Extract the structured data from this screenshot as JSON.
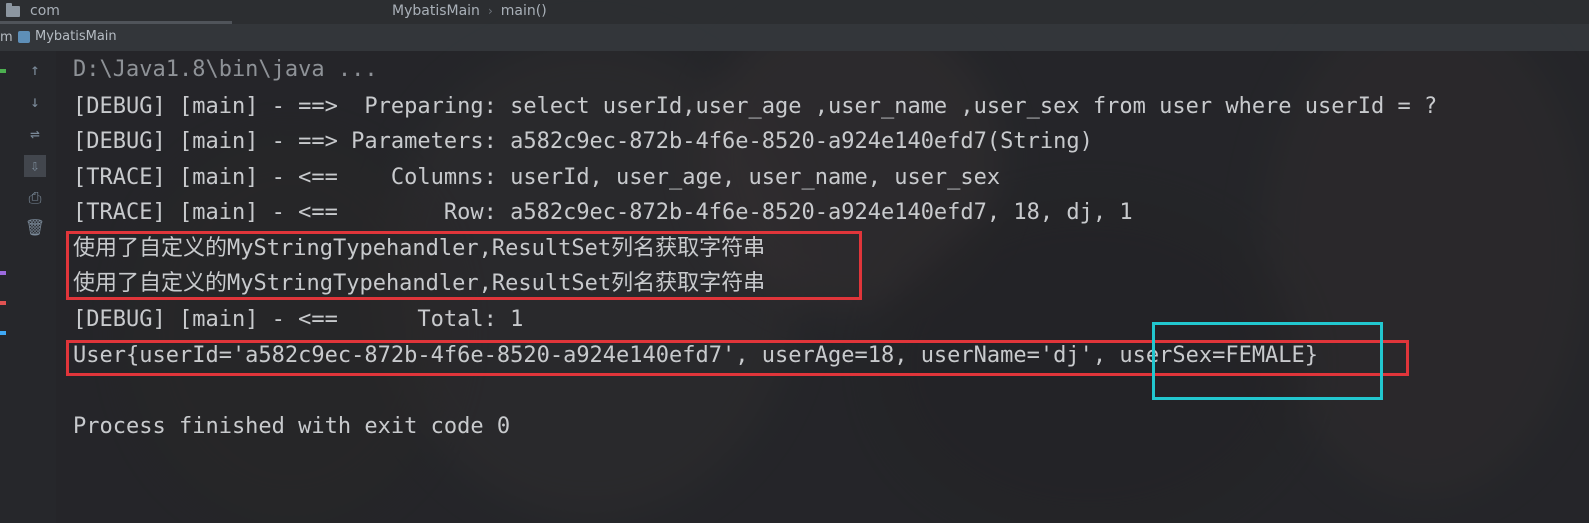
{
  "topbar": {
    "project": "com",
    "breadcrumb_class": "MybatisMain",
    "breadcrumb_sep": "›",
    "breadcrumb_method": "main()"
  },
  "run": {
    "prefix": "m",
    "tab_label": "MybatisMain"
  },
  "toolbar": {
    "icons": [
      "rerun-icon",
      "stop-icon",
      "settings-icon",
      "scroll-to-end-icon",
      "print-icon",
      "trash-icon"
    ]
  },
  "console": {
    "lines": [
      "D:\\Java1.8\\bin\\java ...",
      "[DEBUG] [main] - ==>  Preparing: select userId,user_age ,user_name ,user_sex from user where userId = ?",
      "[DEBUG] [main] - ==> Parameters: a582c9ec-872b-4f6e-8520-a924e140efd7(String)",
      "[TRACE] [main] - <==    Columns: userId, user_age, user_name, user_sex",
      "[TRACE] [main] - <==        Row: a582c9ec-872b-4f6e-8520-a924e140efd7, 18, dj, 1",
      "使用了自定义的MyStringTypehandler,ResultSet列名获取字符串",
      "使用了自定义的MyStringTypehandler,ResultSet列名获取字符串",
      "[DEBUG] [main] - <==      Total: 1",
      "User{userId='a582c9ec-872b-4f6e-8520-a924e140efd7', userAge=18, userName='dj', userSex=FEMALE}",
      "",
      "Process finished with exit code 0"
    ]
  },
  "colors": {
    "highlight_red": "#e0353a",
    "highlight_cyan": "#22c7cf",
    "console_text": "#c8cacd"
  }
}
